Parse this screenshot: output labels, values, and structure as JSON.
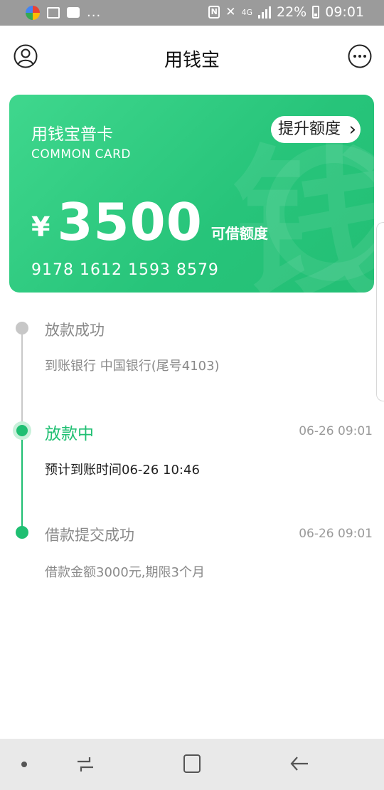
{
  "status_bar": {
    "battery": "22%",
    "time": "09:01",
    "network": "4G",
    "more_dots": "..."
  },
  "header": {
    "title": "用钱宝"
  },
  "card": {
    "name": "用钱宝普卡",
    "subtitle": "COMMON CARD",
    "raise_label": "提升额度",
    "currency": "¥",
    "amount": "3500",
    "amount_label": "可借额度",
    "card_number": "9178  1612  1593  8579",
    "color": "#2bc87d"
  },
  "timeline": [
    {
      "title": "放款成功",
      "time": "",
      "desc": "到账银行 中国银行(尾号4103)",
      "state": "pending"
    },
    {
      "title": "放款中",
      "time": "06-26 09:01",
      "desc": "预计到账时间06-26 10:46",
      "state": "active"
    },
    {
      "title": "借款提交成功",
      "time": "06-26 09:01",
      "desc": "借款金额3000元,期限3个月",
      "state": "done"
    }
  ],
  "colors": {
    "accent": "#1fbf72",
    "gray": "#bdbdbd",
    "text_muted": "#8a8a8a"
  },
  "icons": {
    "avatar": "user-circle-icon",
    "more": "more-dots-icon",
    "raise_chevron": "chevron-right-icon"
  }
}
